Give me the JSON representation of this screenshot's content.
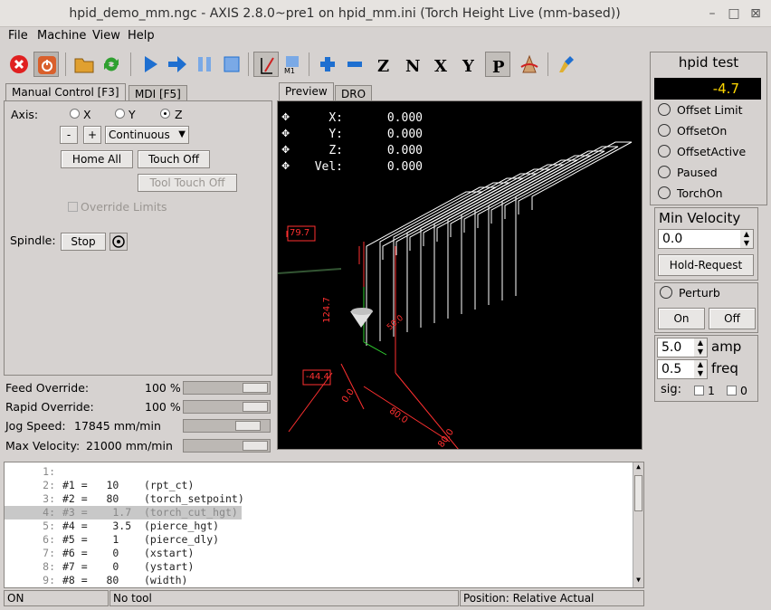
{
  "window": {
    "title": "hpid_demo_mm.ngc - AXIS 2.8.0~pre1 on hpid_mm.ini (Torch Height Live (mm-based))",
    "min": "–",
    "max": "□",
    "close": "⊠"
  },
  "menu": [
    "File",
    "Machine",
    "View",
    "Help"
  ],
  "toolbar_icons": [
    "estop-icon",
    "power-icon",
    "open-file-icon",
    "reload-icon",
    "run-icon",
    "step-icon",
    "pause-icon",
    "stop-icon",
    "block-delete-icon",
    "optional-stop-icon",
    "zoom-in-icon",
    "zoom-out-icon",
    "view-z-icon",
    "view-z2-icon",
    "view-x-icon",
    "view-y-icon",
    "view-p-icon",
    "rotate-icon",
    "clear-plot-icon"
  ],
  "left_tabs": [
    "Manual Control [F3]",
    "MDI [F5]"
  ],
  "manual": {
    "axis_label": "Axis:",
    "axes": [
      "X",
      "Y",
      "Z"
    ],
    "selected_axis": "Z",
    "minus": "-",
    "plus": "+",
    "jog_mode": "Continuous",
    "home_all": "Home All",
    "touch_off": "Touch Off",
    "tool_touch_off": "Tool Touch Off",
    "override_limits": "Override Limits",
    "spindle_label": "Spindle:",
    "spindle_stop": "Stop"
  },
  "overrides": [
    {
      "label": "Feed Override:",
      "value": "100 %",
      "level": 1.0
    },
    {
      "label": "Rapid Override:",
      "value": "100 %",
      "level": 1.0
    },
    {
      "label": "Jog Speed:",
      "value": "17845 mm/min",
      "level": 0.85
    },
    {
      "label": "Max Velocity:",
      "value": "21000 mm/min",
      "level": 1.0
    }
  ],
  "preview_tabs": [
    "Preview",
    "DRO"
  ],
  "dro": [
    {
      "axis": "X:",
      "value": "0.000"
    },
    {
      "axis": "Y:",
      "value": "0.000"
    },
    {
      "axis": "Z:",
      "value": "0.000"
    },
    {
      "axis": "Vel:",
      "value": "0.000"
    }
  ],
  "dims": {
    "d1": "79.7",
    "d2": "124.7",
    "d3": "-44.4",
    "d4": "0.0",
    "d5": "80.0",
    "d6": "80.0",
    "d7": "50.0"
  },
  "right": {
    "title": "hpid test",
    "readout": "-4.7",
    "leds": [
      "Offset Limit",
      "OffsetOn",
      "OffsetActive",
      "Paused",
      "TorchOn"
    ],
    "min_velocity_label": "Min Velocity",
    "min_velocity_value": "0.0",
    "hold_request": "Hold-Request",
    "perturb": "Perturb",
    "on": "On",
    "off": "Off",
    "amp_value": "5.0",
    "amp_label": "amp",
    "freq_value": "0.5",
    "freq_label": "freq",
    "sig_label": "sig:",
    "sig1": "1",
    "sig0": "0"
  },
  "code_lines": [
    {
      "n": "1:",
      "text": ""
    },
    {
      "n": "2:",
      "text": "#1 =   10    (rpt_ct)"
    },
    {
      "n": "3:",
      "text": "#2 =   80    (torch_setpoint)"
    },
    {
      "n": "4:",
      "text": "#3 =    1.7  (torch_cut_hgt)"
    },
    {
      "n": "5:",
      "text": "#4 =    3.5  (pierce_hgt)"
    },
    {
      "n": "6:",
      "text": "#5 =    1    (pierce_dly)"
    },
    {
      "n": "7:",
      "text": "#6 =    0    (xstart)"
    },
    {
      "n": "8:",
      "text": "#7 =    0    (ystart)"
    },
    {
      "n": "9:",
      "text": "#8 =   80    (width)"
    }
  ],
  "selected_line": 4,
  "status": {
    "state": "ON",
    "tool": "No tool",
    "position": "Position: Relative Actual"
  },
  "colors": {
    "readout_bg": "#000000",
    "readout_fg": "#ffd700",
    "estop": "#e02020",
    "run": "#1e6fd0"
  }
}
